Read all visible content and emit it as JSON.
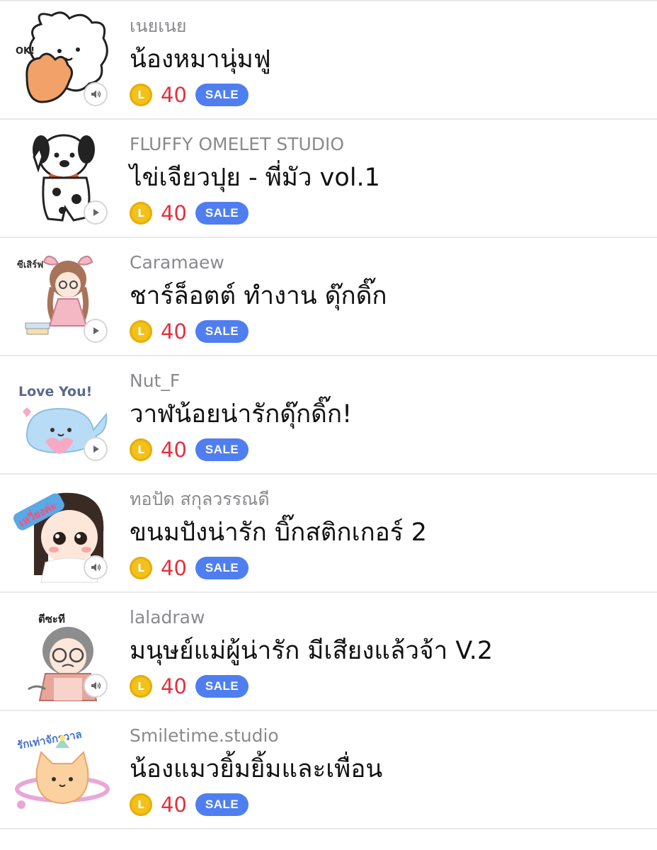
{
  "accent_color": "#4f7ef0",
  "price_color": "#e3303d",
  "coin_color": "#f2c21b",
  "stickers": [
    {
      "author": "เนยเนย",
      "title": "น้องหมานุ่มฟู",
      "price": "40",
      "coin_letter": "L",
      "badge": "SALE",
      "media": "sound",
      "media_icon": "speaker-icon",
      "image_text": "OK!"
    },
    {
      "author": "FLUFFY OMELET STUDIO",
      "title": "ไข่เจียวปุย - พี่มัว vol.1",
      "price": "40",
      "coin_letter": "L",
      "badge": "SALE",
      "media": "animation",
      "media_icon": "play-icon"
    },
    {
      "author": "Caramaew",
      "title": "ชาร์ล็อตต์ ทำงาน ดุ๊กดิ๊ก",
      "price": "40",
      "coin_letter": "L",
      "badge": "SALE",
      "media": "animation",
      "media_icon": "play-icon",
      "image_text": "ซีเสิร์ฟ"
    },
    {
      "author": "Nut_F",
      "title": "วาฬน้อยน่ารักดุ๊กดิ๊ก!",
      "price": "40",
      "coin_letter": "L",
      "badge": "SALE",
      "media": "animation",
      "media_icon": "play-icon",
      "image_text": "Love You!"
    },
    {
      "author": "ทอปัด สกุลวรรณดี",
      "title": "ขนมปังน่ารัก บิ๊กสติกเกอร์ 2",
      "price": "40",
      "coin_letter": "L",
      "badge": "SALE",
      "media": "sound",
      "media_icon": "speaker-icon",
      "image_text": "เหวี่ยงค่ะ"
    },
    {
      "author": "laladraw",
      "title": "มนุษย์แม่ผู้น่ารัก มีเสียงแล้วจ้า V.2",
      "price": "40",
      "coin_letter": "L",
      "badge": "SALE",
      "media": "sound",
      "media_icon": "speaker-icon",
      "image_text": "ตีซะที"
    },
    {
      "author": "Smiletime.studio",
      "title": "น้องแมวยิ้มยิ้มและเพื่อน",
      "price": "40",
      "coin_letter": "L",
      "badge": "SALE",
      "media": "none",
      "image_text": "รักเท่าจักรวาล"
    }
  ]
}
